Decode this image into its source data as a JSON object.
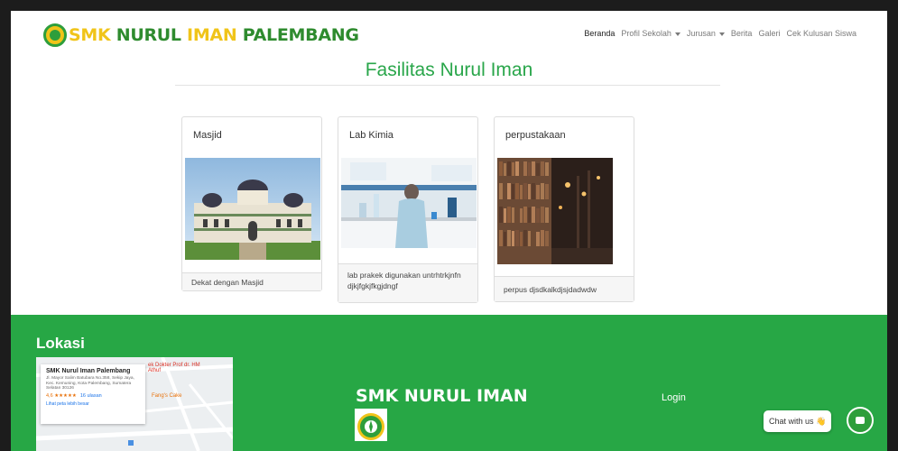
{
  "brand": {
    "part1": "SMK",
    "part2": " NURUL ",
    "part3": "IMAN",
    "part4": " PALEMBANG"
  },
  "nav": {
    "items": [
      "Beranda",
      "Profil Sekolah",
      "Jurusan",
      "Berita",
      "Galeri",
      "Cek Kulusan Siswa"
    ],
    "active": "Beranda"
  },
  "section": {
    "title": "Fasilitas Nurul Iman"
  },
  "cards": [
    {
      "title": "Masjid",
      "description": "Dekat dengan Masjid"
    },
    {
      "title": "Lab Kimia",
      "description": "lab prakek digunakan untrhtrkjnfndjkjfgkjfkgjdngf"
    },
    {
      "title": "perpustakaan",
      "description": "perpus djsdkalkdjsjdadwdw"
    }
  ],
  "footer": {
    "location_heading": "Lokasi",
    "school_name": "SMK NURUL IMAN",
    "login_label": "Login",
    "map": {
      "place_name": "SMK Nurul Iman Palembang",
      "address": "Jl. Mayor Salim Batubara No.358, Sekip Jaya, Kec. Kemuning, Kota Palembang, Sumatera Selatan 30126",
      "rating": "4,6",
      "stars": "★★★★★",
      "reviews": "16 ulasan",
      "larger_map_link": "Lihat peta lebih besar",
      "poi_1": "ek Dokter Prof dr. HM Athuf",
      "poi_2": "Fang's Cake"
    }
  },
  "chat": {
    "label": "Chat with us",
    "emoji": "👋"
  },
  "colors": {
    "brand_green": "#27a745",
    "brand_yellow": "#f0c419",
    "title_green": "#29a64a"
  }
}
